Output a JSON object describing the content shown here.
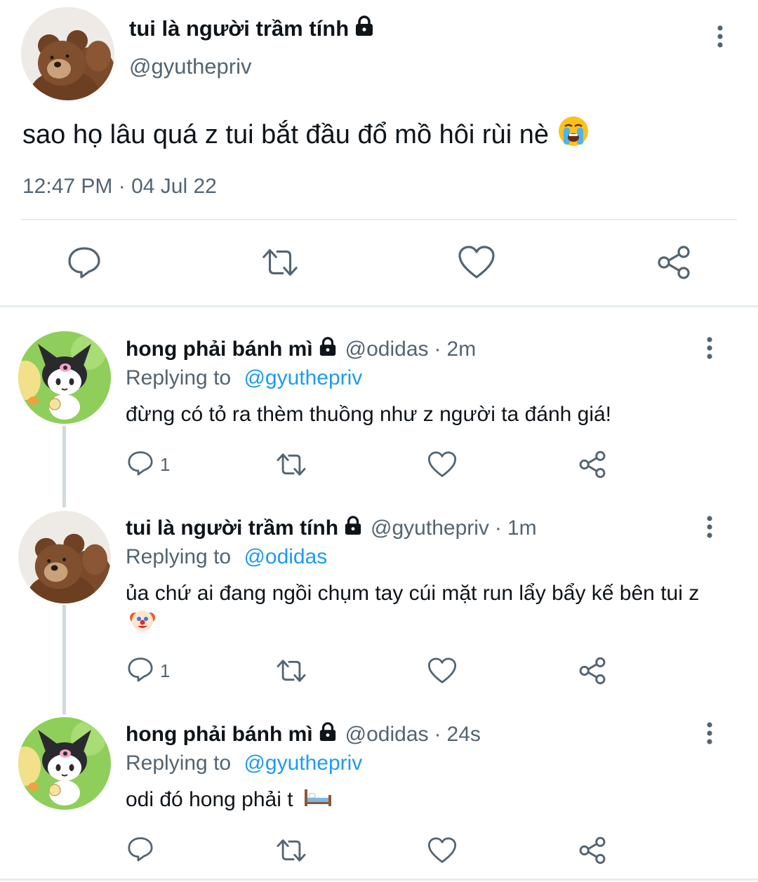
{
  "main_tweet": {
    "display_name": "tui là người trầm tính",
    "handle": "@gyuthepriv",
    "text": "sao họ lâu quá z tui bắt đầu đổ mồ hôi rùi nè",
    "timestamp": "12:47 PM · 04 Jul 22",
    "icons": {
      "lock": "lock-icon",
      "emoji": "loudly-crying-face-emoji",
      "more": "more-vertical-icon",
      "reply": "reply-icon",
      "retweet": "retweet-icon",
      "like": "heart-icon",
      "share": "share-icon"
    }
  },
  "replies": [
    {
      "display_name": "hong phải bánh mì",
      "handle": "@odidas",
      "dot": "·",
      "time": "2m",
      "replying_label": "Replying to",
      "replying_to": "@gyuthepriv",
      "text": "đừng có tỏ ra thèm thuồng như z người ta đánh giá!",
      "reply_count": "1",
      "avatar": "kuromi-avatar"
    },
    {
      "display_name": "tui là người trầm tính",
      "handle": "@gyuthepriv",
      "dot": "·",
      "time": "1m",
      "replying_label": "Replying to",
      "replying_to": "@odidas",
      "text": "ủa chứ ai đang ngồi chụm tay cúi mặt run lẩy bẩy kế bên tui z",
      "emoji": "clown-face-emoji",
      "reply_count": "1",
      "avatar": "teddy-bear-avatar"
    },
    {
      "display_name": "hong phải bánh mì",
      "handle": "@odidas",
      "dot": "·",
      "time": "24s",
      "replying_label": "Replying to",
      "replying_to": "@gyuthepriv",
      "text": "odi đó hong phải t",
      "emoji": "bed-emoji",
      "reply_count": "",
      "avatar": "kuromi-avatar"
    }
  ],
  "colors": {
    "text": "#0f1419",
    "secondary": "#536471",
    "link": "#1d9bf0",
    "divider": "#e6ecf0",
    "thread_line": "#cfd9de"
  }
}
